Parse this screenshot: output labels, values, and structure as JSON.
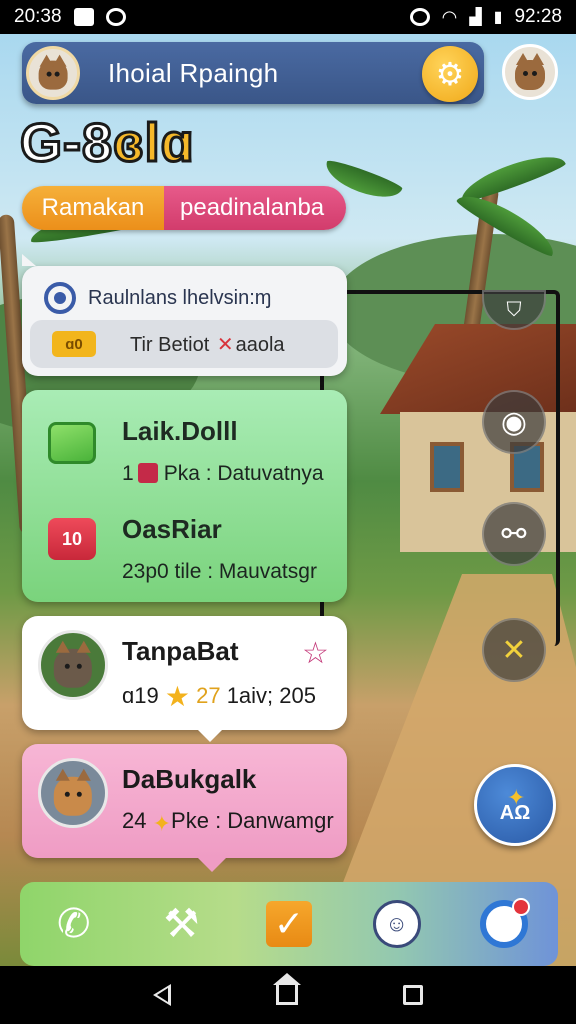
{
  "status_bar": {
    "time": "20:38",
    "clock": "92:28"
  },
  "header": {
    "title": "Ihoial Rpaingh"
  },
  "game_title": {
    "main": "G-8",
    "accent": "ɞlɑ"
  },
  "tabs": [
    {
      "label": "Ramakan"
    },
    {
      "label": "peadinalanba"
    }
  ],
  "search": {
    "text": "Raulnlans lhelvsin:ɱ",
    "filter_tag": "ɑ0",
    "filter_before": "Tir Betiot",
    "filter_after": "aaola"
  },
  "items": [
    {
      "title": "Laik.Dolll",
      "sub_prefix": "1",
      "sub_suffix": "Pka : Datuvatnya"
    },
    {
      "title": "OasRiar",
      "sub": "23p0 tile : Mauvatsgr",
      "icon_text": "10"
    }
  ],
  "profiles": [
    {
      "name": "TanpaBat",
      "meta_prefix": "ɑ19",
      "meta_number": "27",
      "meta_suffix": "1aiv; 205"
    },
    {
      "name": "DaBukgalk",
      "meta_prefix": "24",
      "meta_suffix": "Pke : Danwamgr"
    }
  ],
  "fab": {
    "label": "AΩ"
  },
  "colors": {
    "header": "#3a5688",
    "accent_yellow": "#f5b82a",
    "tab_orange": "#ec8f1a",
    "tab_pink": "#d23c6c",
    "card_green": "#7ad37c",
    "card_pink": "#ef9cc4",
    "fab_blue": "#2a5aa6"
  }
}
